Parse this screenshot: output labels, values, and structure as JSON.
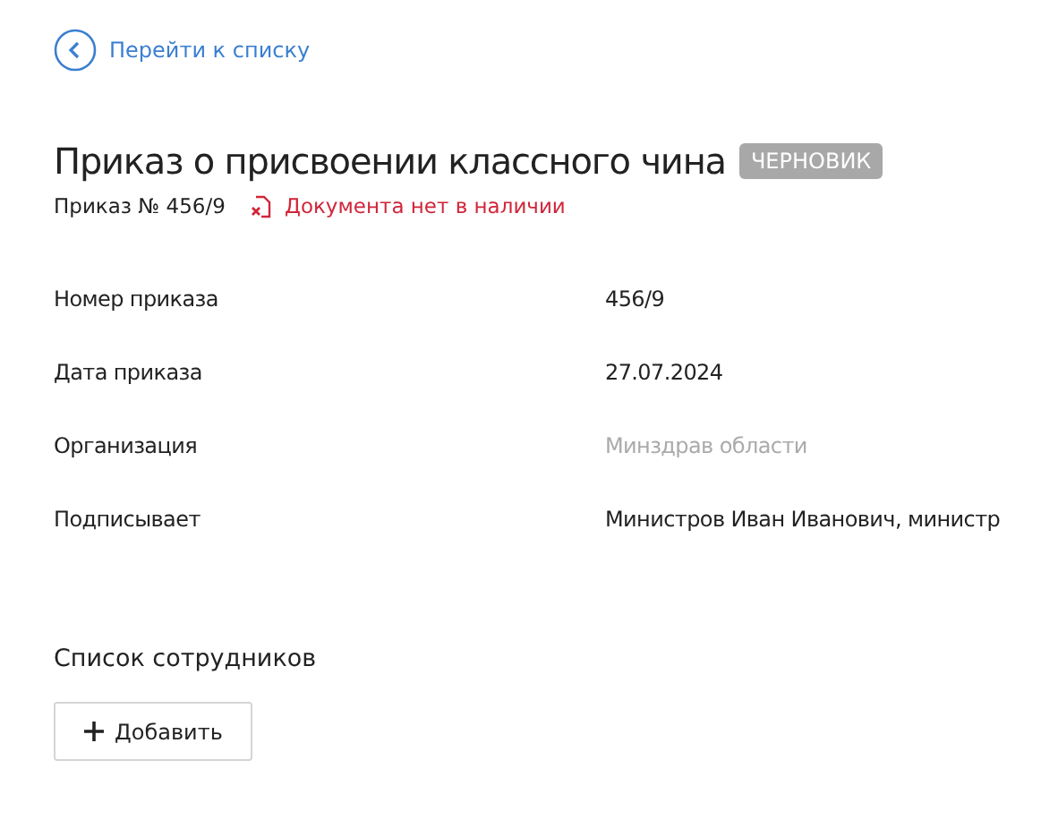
{
  "back_link": {
    "label": "Перейти к списку"
  },
  "title": "Приказ о присвоении классного чина",
  "status_badge": "ЧЕРНОВИК",
  "order_number": "Приказ № 456/9",
  "document_status": {
    "label": "Документа нет в наличии",
    "available": false
  },
  "fields": [
    {
      "label": "Номер приказа",
      "value": "456/9",
      "muted": false
    },
    {
      "label": "Дата приказа",
      "value": "27.07.2024",
      "muted": false
    },
    {
      "label": "Организация",
      "value": "Минздрав области",
      "muted": true
    },
    {
      "label": "Подписывает",
      "value": "Министров Иван Иванович, министр",
      "muted": false
    }
  ],
  "employees_section": {
    "title": "Список сотрудников",
    "add_button": "Добавить"
  }
}
